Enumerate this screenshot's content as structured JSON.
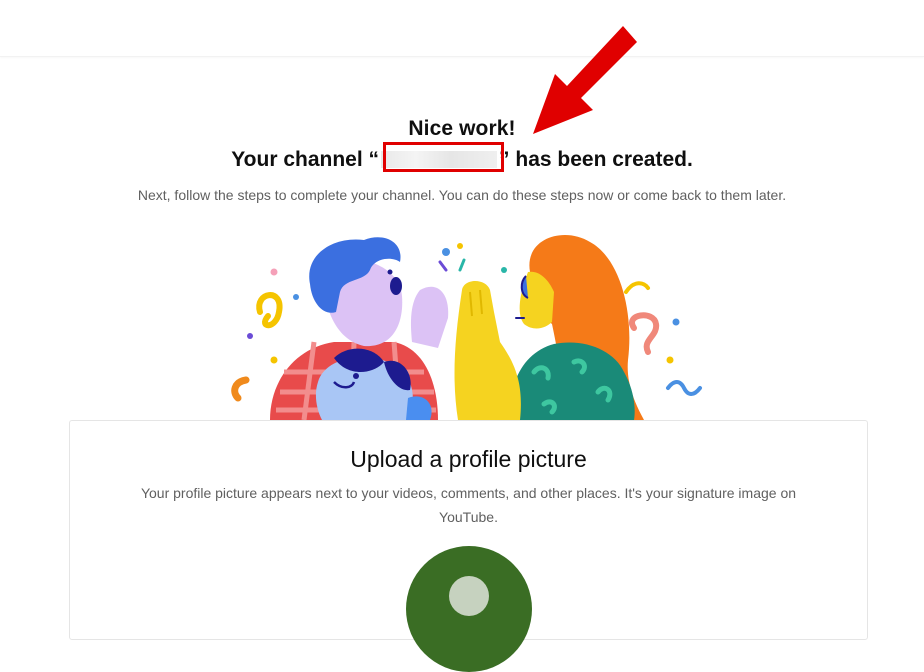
{
  "header": {
    "headline": "Nice work!",
    "channel_prefix": "Your channel “",
    "channel_suffix": "” has been created.",
    "subtitle": "Next, follow the steps to complete your channel. You can do these steps now or come back to them later."
  },
  "card": {
    "title": "Upload a profile picture",
    "description": "Your profile picture appears next to your videos, comments, and other places. It's your signature image on YouTube."
  },
  "colors": {
    "annotation_red": "#e00000",
    "avatar_green": "#3a6d24"
  },
  "icons": {
    "arrow": "red-arrow-icon",
    "avatar": "profile-avatar-icon"
  }
}
